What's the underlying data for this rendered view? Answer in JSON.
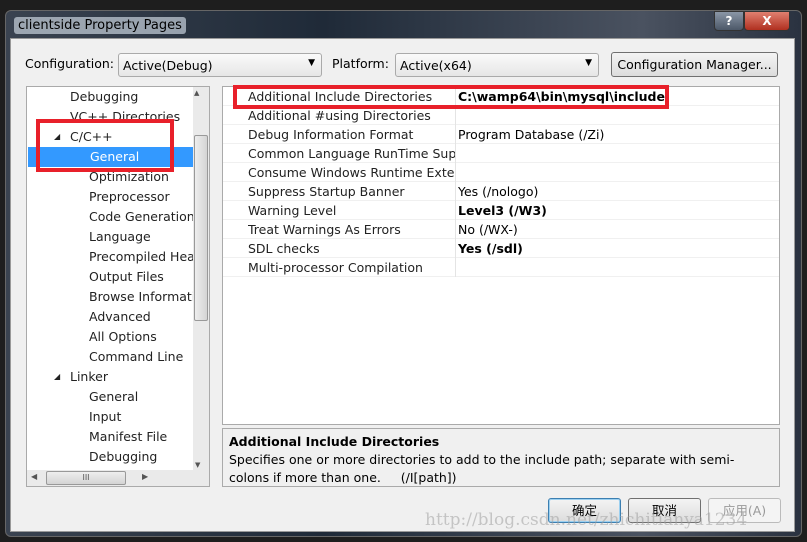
{
  "window": {
    "title": "clientside Property Pages",
    "help_label": "?",
    "close_label": "X"
  },
  "config": {
    "configuration_label": "Configuration:",
    "configuration_value": "Active(Debug)",
    "platform_label": "Platform:",
    "platform_value": "Active(x64)",
    "manager_button": "Configuration Manager..."
  },
  "tree": {
    "items": [
      {
        "label": "Debugging",
        "level": 1
      },
      {
        "label": "VC++ Directories",
        "level": 1
      },
      {
        "label": "C/C++",
        "level": 1,
        "expanded": true
      },
      {
        "label": "General",
        "level": 2,
        "selected": true
      },
      {
        "label": "Optimization",
        "level": 2
      },
      {
        "label": "Preprocessor",
        "level": 2
      },
      {
        "label": "Code Generation",
        "level": 2
      },
      {
        "label": "Language",
        "level": 2
      },
      {
        "label": "Precompiled Head",
        "level": 2
      },
      {
        "label": "Output Files",
        "level": 2
      },
      {
        "label": "Browse Informati",
        "level": 2
      },
      {
        "label": "Advanced",
        "level": 2
      },
      {
        "label": "All Options",
        "level": 2
      },
      {
        "label": "Command Line",
        "level": 2
      },
      {
        "label": "Linker",
        "level": 1,
        "expanded": true
      },
      {
        "label": "General",
        "level": 2
      },
      {
        "label": "Input",
        "level": 2
      },
      {
        "label": "Manifest File",
        "level": 2
      },
      {
        "label": "Debugging",
        "level": 2
      }
    ],
    "expand_glyph": "◢",
    "hscroll_grip": "III"
  },
  "properties": [
    {
      "name": "Additional Include Directories",
      "value": "C:\\wamp64\\bin\\mysql\\include",
      "bold": true
    },
    {
      "name": "Additional #using Directories",
      "value": ""
    },
    {
      "name": "Debug Information Format",
      "value": "Program Database (/Zi)"
    },
    {
      "name": "Common Language RunTime Support",
      "value": ""
    },
    {
      "name": "Consume Windows Runtime Extension",
      "value": ""
    },
    {
      "name": "Suppress Startup Banner",
      "value": "Yes (/nologo)"
    },
    {
      "name": "Warning Level",
      "value": "Level3 (/W3)",
      "bold": true
    },
    {
      "name": "Treat Warnings As Errors",
      "value": "No (/WX-)"
    },
    {
      "name": "SDL checks",
      "value": "Yes (/sdl)",
      "bold": true
    },
    {
      "name": "Multi-processor Compilation",
      "value": ""
    }
  ],
  "description": {
    "title": "Additional Include Directories",
    "text": "Specifies one or more directories to add to the include path; separate with semi-colons if more than one.     (/I[path])"
  },
  "buttons": {
    "ok": "确定",
    "cancel": "取消",
    "apply": "应用(A)"
  },
  "watermark": "http://blog.csdn.net/zhichitianya1234",
  "colors": {
    "selection": "#3399ff",
    "highlight_box": "#e8202a"
  }
}
